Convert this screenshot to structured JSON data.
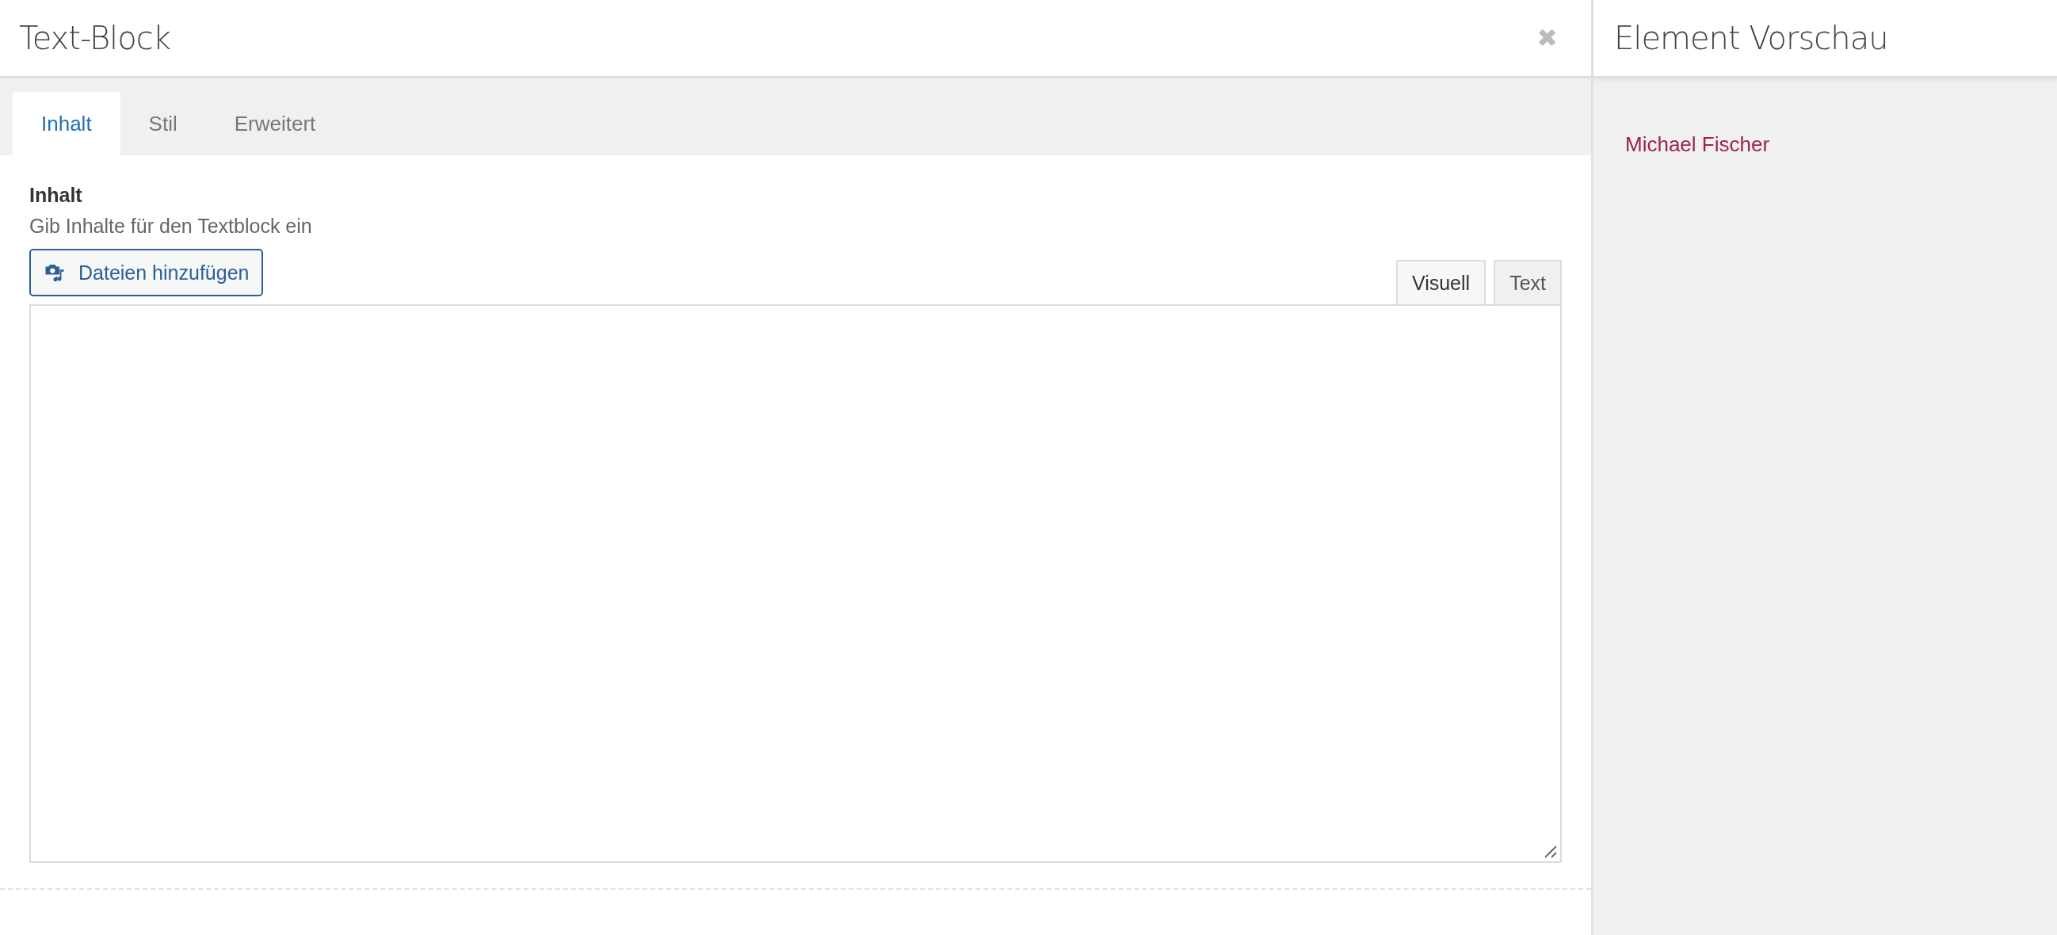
{
  "dialog": {
    "title": "Text-Block",
    "close": "✖"
  },
  "tabs": [
    {
      "label": "Inhalt",
      "selected": true
    },
    {
      "label": "Stil",
      "selected": false
    },
    {
      "label": "Erweitert",
      "selected": false
    }
  ],
  "field": {
    "label": "Inhalt",
    "description": "Gib Inhalte für den Textblock ein",
    "add_media_button": "Dateien hinzufügen"
  },
  "editor_tabs": [
    {
      "label": "Visuell",
      "selected": true
    },
    {
      "label": "Text",
      "selected": false
    }
  ],
  "preview": {
    "title": "Element Vorschau",
    "content": "Michael Fischer"
  }
}
